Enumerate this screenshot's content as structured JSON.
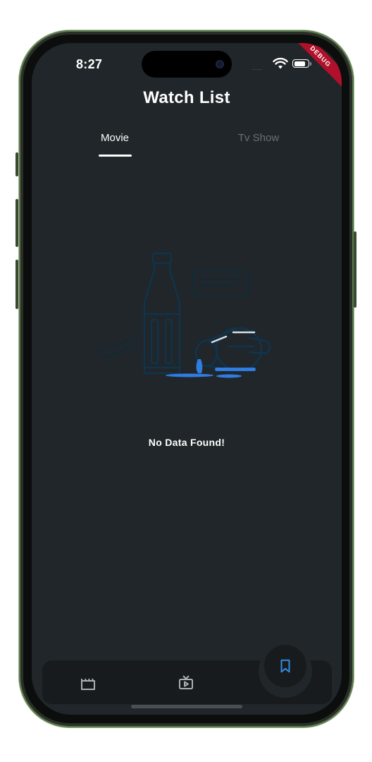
{
  "status_bar": {
    "time": "8:27",
    "signal_dots": "....",
    "wifi_icon": "wifi-icon",
    "battery_icon": "battery-icon",
    "debug_banner": "DEBUG"
  },
  "header": {
    "title": "Watch List"
  },
  "tabs": [
    {
      "label": "Movie",
      "selected": true
    },
    {
      "label": "Tv Show",
      "selected": false
    }
  ],
  "empty_state": {
    "illustration_icon": "spilled-bottle-and-glass-illustration",
    "message": "No Data Found!"
  },
  "bottom_nav": {
    "items": [
      {
        "icon": "clapperboard-icon",
        "selected": false
      },
      {
        "icon": "tv-icon",
        "selected": false
      },
      {
        "icon": "bookmark-icon",
        "selected": true
      }
    ]
  },
  "colors": {
    "background": "#202629",
    "bar": "#171b1d",
    "accent": "#2f8de4",
    "text": "#ffffff",
    "muted_text": "#6a7074"
  }
}
